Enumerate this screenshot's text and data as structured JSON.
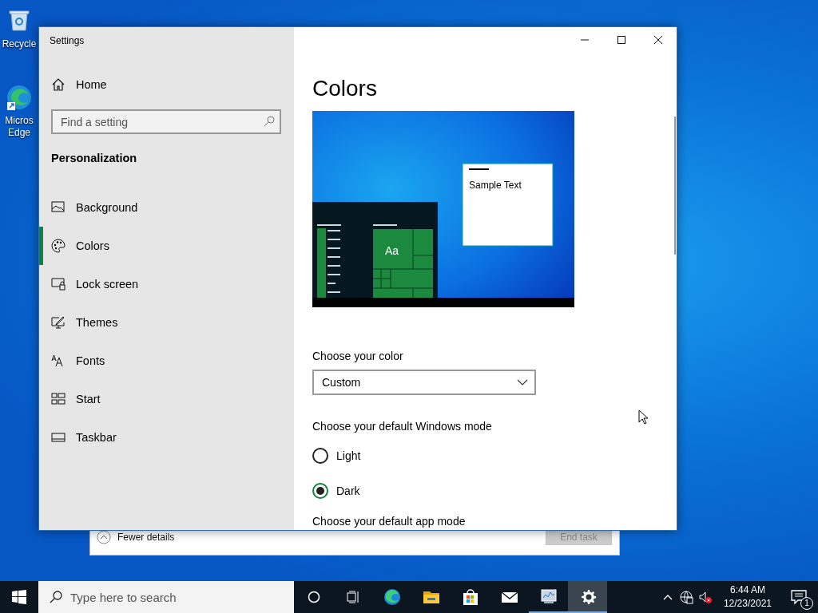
{
  "desktop_icons": [
    {
      "label": "Recycle"
    },
    {
      "label": "Micros Edge"
    }
  ],
  "background_window": {
    "details_toggle": "Fewer details",
    "button": {
      "label": "End task",
      "disabled": true
    }
  },
  "window": {
    "title": "Settings"
  },
  "sidebar": {
    "home": "Home",
    "search": {
      "placeholder": "Find a setting"
    },
    "section": "Personalization",
    "items": [
      {
        "label": "Background",
        "selected": false
      },
      {
        "label": "Colors",
        "selected": true
      },
      {
        "label": "Lock screen",
        "selected": false
      },
      {
        "label": "Themes",
        "selected": false
      },
      {
        "label": "Fonts",
        "selected": false
      },
      {
        "label": "Start",
        "selected": false
      },
      {
        "label": "Taskbar",
        "selected": false
      }
    ]
  },
  "content": {
    "title": "Colors",
    "preview": {
      "tile_text": "Aa",
      "sample_text": "Sample Text"
    },
    "color_label": "Choose your color",
    "color_dropdown": {
      "value": "Custom"
    },
    "mode_label": "Choose your default Windows mode",
    "mode_options": [
      {
        "label": "Light",
        "selected": false
      },
      {
        "label": "Dark",
        "selected": true
      }
    ],
    "next_label": "Choose your default app mode"
  },
  "taskbar": {
    "search": {
      "placeholder": "Type here to search"
    },
    "apps": [
      {
        "selected": false,
        "running": false
      },
      {
        "selected": false,
        "running": false
      },
      {
        "selected": false,
        "running": false
      },
      {
        "selected": false,
        "running": false
      },
      {
        "selected": false,
        "running": true
      },
      {
        "selected": true,
        "running": true
      }
    ],
    "time": "6:44 AM",
    "date": "12/23/2021",
    "notification_count": "1"
  }
}
